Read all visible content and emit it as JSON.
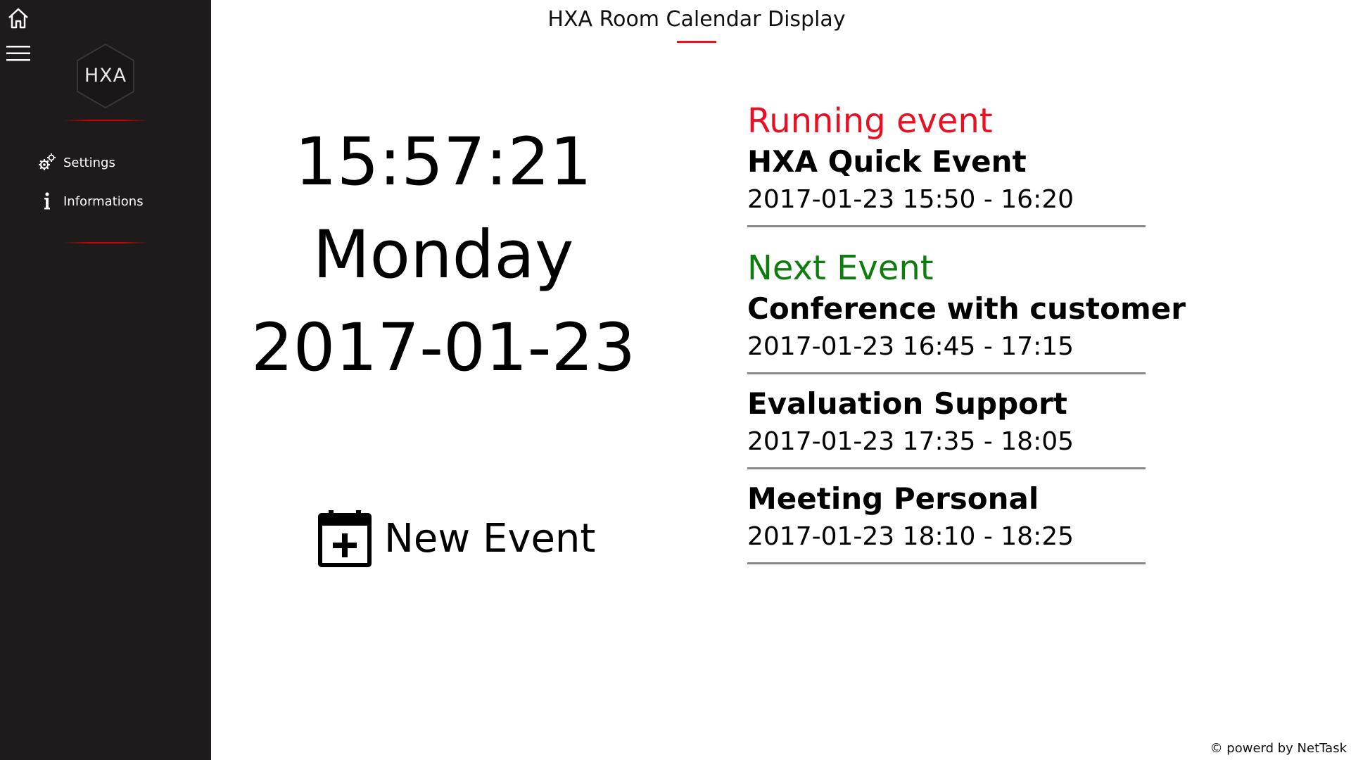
{
  "app": {
    "title": "HXA Room Calendar Display",
    "accent_color": "#e81123"
  },
  "sidebar": {
    "logo_text": "HXA",
    "home_icon": "home-icon",
    "menu_icon": "hamburger-menu-icon",
    "items": [
      {
        "label": "Settings",
        "icon": "gears-icon"
      },
      {
        "label": "Informations",
        "icon": "info-icon"
      }
    ]
  },
  "clock": {
    "time": "15:57:21",
    "day": "Monday",
    "date": "2017-01-23"
  },
  "new_event": {
    "label": "New Event",
    "icon": "calendar-add-icon"
  },
  "running": {
    "heading": "Running event",
    "heading_color": "#e81123",
    "event": {
      "title": "HXA Quick Event",
      "time": "2017-01-23 15:50 - 16:20"
    }
  },
  "next": {
    "heading": "Next Event",
    "heading_color": "#107c10",
    "events": [
      {
        "title": "Conference with customer",
        "time": "2017-01-23 16:45 - 17:15"
      },
      {
        "title": "Evaluation Support",
        "time": "2017-01-23 17:35 - 18:05"
      },
      {
        "title": "Meeting Personal",
        "time": "2017-01-23 18:10 - 18:25"
      }
    ]
  },
  "footer": {
    "text": "© powerd by NetTask"
  }
}
